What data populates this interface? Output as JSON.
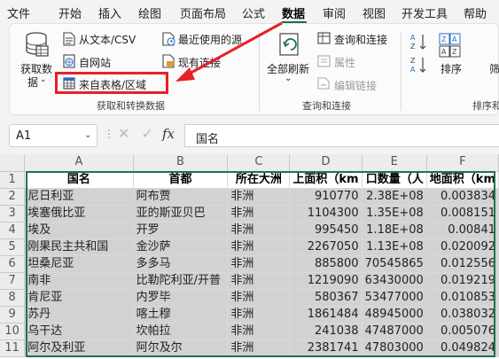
{
  "tabs": [
    "文件",
    "开始",
    "插入",
    "绘图",
    "页面布局",
    "公式",
    "数据",
    "审阅",
    "视图",
    "开发工具",
    "帮助"
  ],
  "active_tab": "数据",
  "ribbon": {
    "get_data_label_1": "获取数",
    "get_data_label_2": "据",
    "from_text_csv": "从文本/CSV",
    "from_web": "自网站",
    "from_table_range": "来自表格/区域",
    "recent_sources": "最近使用的源",
    "existing_connections": "现有连接",
    "group_get_transform": "获取和转换数据",
    "refresh_all_1": "全部刷新",
    "queries_connections": "查询和连接",
    "properties": "属性",
    "edit_links": "编辑链接",
    "group_queries": "查询和连接",
    "sort_label": "排序",
    "filter_label": "筛",
    "group_sort_filter": "排序和"
  },
  "formula_bar": {
    "name_box": "A1",
    "content": "国名",
    "fx": "fx",
    "cancel_glyph": "✕",
    "enter_glyph": "✓"
  },
  "grid": {
    "columns": [
      "A",
      "B",
      "C",
      "D",
      "E",
      "F"
    ],
    "row_numbers": [
      "1",
      "2",
      "3",
      "4",
      "5",
      "6",
      "7",
      "8",
      "9",
      "10",
      "11"
    ],
    "header": [
      "国名",
      "首都",
      "所在大洲",
      "上面积（km",
      "口数量（人",
      "地面积（km"
    ],
    "rows": [
      [
        "尼日利亚",
        "阿布贾",
        "非洲",
        "910770",
        "2.38E+08",
        "0.003834"
      ],
      [
        "埃塞俄比亚",
        "亚的斯亚贝巴",
        "非洲",
        "1104300",
        "1.35E+08",
        "0.008151"
      ],
      [
        "埃及",
        "开罗",
        "非洲",
        "995450",
        "1.18E+08",
        "0.00841"
      ],
      [
        "刚果民主共和国",
        "金沙萨",
        "非洲",
        "2267050",
        "1.13E+08",
        "0.020092"
      ],
      [
        "坦桑尼亚",
        "多多马",
        "非洲",
        "885800",
        "70545865",
        "0.012556"
      ],
      [
        "南非",
        "比勒陀利亚/开普",
        "非洲",
        "1219090",
        "63430000",
        "0.019219"
      ],
      [
        "肯尼亚",
        "内罗毕",
        "非洲",
        "580367",
        "53477000",
        "0.010853"
      ],
      [
        "苏丹",
        "喀土穆",
        "非洲",
        "1861484",
        "48945000",
        "0.038032"
      ],
      [
        "乌干达",
        "坎帕拉",
        "非洲",
        "241038",
        "47487000",
        "0.005076"
      ],
      [
        "阿尔及利亚",
        "阿尔及尔",
        "非洲",
        "2381741",
        "47803000",
        "0.049824"
      ]
    ]
  },
  "colors": {
    "accent_green": "#217346",
    "highlight_red": "#e8202a"
  }
}
